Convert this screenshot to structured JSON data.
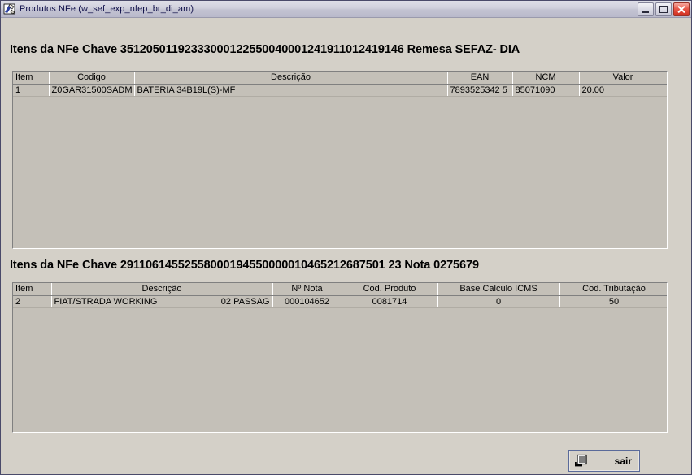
{
  "window": {
    "title": "Produtos NFe (w_sef_exp_nfep_br_di_am)",
    "icon": "app-window-icon",
    "buttons": {
      "minimize": "minimize-button",
      "maximize": "maximize-button",
      "close": "close-button"
    }
  },
  "section1": {
    "title": "Itens da NFe Chave 35120501192333000122550040001241911012419146 Remesa SEFAZ- DIA",
    "columns": [
      "Item",
      "Codigo",
      "Descrição",
      "EAN",
      "NCM",
      "Valor"
    ],
    "rows": [
      {
        "item": "1",
        "codigo": "Z0GAR31500SADM",
        "descricao": "BATERIA 34B19L(S)-MF",
        "ean": "7893525342 5",
        "ncm": "85071090",
        "valor": "20.00"
      }
    ]
  },
  "section2": {
    "title": "Itens da NFe Chave 29110614552558000194550000010465212687501 23 Nota 0275679",
    "columns": [
      "Item",
      "Descrição",
      "Nº Nota",
      "Cod. Produto",
      "Base Calculo ICMS",
      "Cod. Tributação"
    ],
    "rows": [
      {
        "item": "2",
        "descricao": "FIAT/STRADA WORKING",
        "descricao_suffix": "02 PASSAG",
        "num_nota": "000104652",
        "cod_produto": "0081714",
        "base_calculo_icms": "0",
        "cod_tributacao": "50"
      }
    ]
  },
  "footer": {
    "exit_label": "sair",
    "exit_icon": "exit-print-icon"
  },
  "colors": {
    "window_face": "#d4d0c8",
    "grid_face": "#c4c0b8",
    "title_text": "#10104a",
    "close_red": "#cf2d1e",
    "focus_border": "#5a6a9a"
  }
}
